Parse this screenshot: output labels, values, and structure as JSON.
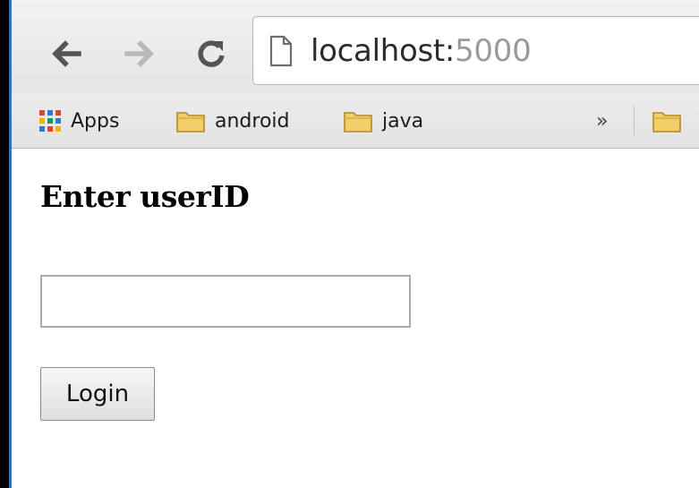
{
  "browser": {
    "url_host": "localhost:",
    "url_port": "5000",
    "bookmarks": {
      "apps_label": "Apps",
      "android_label": "android",
      "java_label": "java",
      "overflow_label": "»"
    },
    "icons": {
      "back": "back-arrow-icon",
      "forward": "forward-arrow-icon",
      "reload": "reload-icon",
      "page": "page-icon",
      "apps": "apps-grid-icon",
      "folder": "folder-icon"
    }
  },
  "page": {
    "heading": "Enter userID",
    "userid_value": "",
    "login_label": "Login"
  },
  "colors": {
    "folder": "#f0c45a",
    "window_accent": "#3b6fb6"
  }
}
